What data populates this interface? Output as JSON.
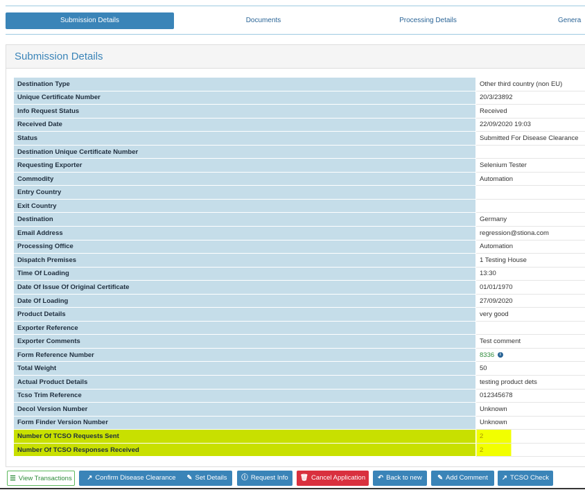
{
  "tabs": [
    {
      "label": "Submission Details",
      "active": true
    },
    {
      "label": "Documents",
      "active": false
    },
    {
      "label": "Processing Details",
      "active": false
    },
    {
      "label": "Genera",
      "active": false
    }
  ],
  "panel": {
    "title": "Submission Details"
  },
  "rows": [
    {
      "key": "Destination Type",
      "value": "Other third country (non EU)"
    },
    {
      "key": "Unique Certificate Number",
      "value": "20/3/23892"
    },
    {
      "key": "Info Request Status",
      "value": "Received"
    },
    {
      "key": "Received Date",
      "value": "22/09/2020 19:03"
    },
    {
      "key": "Status",
      "value": "Submitted For Disease Clearance"
    },
    {
      "key": "Destination Unique Certificate Number",
      "value": ""
    },
    {
      "key": "Requesting Exporter",
      "value": "Selenium Tester"
    },
    {
      "key": "Commodity",
      "value": "Automation"
    },
    {
      "key": "Entry Country",
      "value": ""
    },
    {
      "key": "Exit Country",
      "value": ""
    },
    {
      "key": "Destination",
      "value": "Germany"
    },
    {
      "key": "Email Address",
      "value": "regression@stiona.com"
    },
    {
      "key": "Processing Office",
      "value": "Automation"
    },
    {
      "key": "Dispatch Premises",
      "value": "1 Testing House"
    },
    {
      "key": "Time Of Loading",
      "value": "13:30"
    },
    {
      "key": "Date Of Issue Of Original Certificate",
      "value": "01/01/1970"
    },
    {
      "key": "Date Of Loading",
      "value": "27/09/2020"
    },
    {
      "key": "Product Details",
      "value": "very good"
    },
    {
      "key": "Exporter Reference",
      "value": ""
    },
    {
      "key": "Exporter Comments",
      "value": "Test comment"
    },
    {
      "key": "Form Reference Number",
      "value": "8336"
    },
    {
      "key": "Total Weight",
      "value": "50"
    },
    {
      "key": "Actual Product Details",
      "value": "testing product dets"
    },
    {
      "key": "Tcso Trim Reference",
      "value": "012345678"
    },
    {
      "key": "Decol Version Number",
      "value": "Unknown"
    },
    {
      "key": "Form Finder Version Number",
      "value": "Unknown"
    },
    {
      "key": "Number Of TCSO Requests Sent",
      "value": "2"
    },
    {
      "key": "Number Of TCSO Responses Received",
      "value": "2"
    }
  ],
  "actions": {
    "view_transactions": "View Transactions",
    "confirm_disease_clearance": "Confirm Disease Clearance",
    "set_details": "Set Details",
    "request_info": "Request Info",
    "cancel_application": "Cancel Application",
    "back_to_new": "Back to new",
    "add_comment": "Add Comment",
    "tcso_check": "TCSO Check"
  },
  "colors": {
    "accent": "#3a84b8",
    "key_cell": "#c5dde9",
    "highlight": "#c8e000",
    "danger": "#d9303e",
    "success": "#5cb85c"
  }
}
